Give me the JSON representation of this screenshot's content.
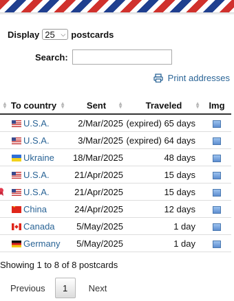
{
  "length": {
    "prefix": "Display",
    "value": "25",
    "suffix": "postcards"
  },
  "search": {
    "label": "Search:",
    "value": "",
    "placeholder": ""
  },
  "print_link": "Print addresses",
  "table": {
    "columns": [
      "To country",
      "Sent",
      "Traveled",
      "Img"
    ],
    "rows": [
      {
        "flag": "us-flag-icon",
        "country": "U.S.A.",
        "sent": "2/Mar/2025",
        "traveled": "(expired) 65 days",
        "marker": ""
      },
      {
        "flag": "us-flag-icon",
        "country": "U.S.A.",
        "sent": "3/Mar/2025",
        "traveled": "(expired) 64 days",
        "marker": ""
      },
      {
        "flag": "ukraine-flag-icon",
        "country": "Ukraine",
        "sent": "18/Mar/2025",
        "traveled": "48 days",
        "marker": ""
      },
      {
        "flag": "us-flag-icon",
        "country": "U.S.A.",
        "sent": "21/Apr/2025",
        "traveled": "15 days",
        "marker": ""
      },
      {
        "flag": "us-flag-icon",
        "country": "U.S.A.",
        "sent": "21/Apr/2025",
        "traveled": "15 days",
        "marker": "ribbon-icon"
      },
      {
        "flag": "china-flag-icon",
        "country": "China",
        "sent": "24/Apr/2025",
        "traveled": "12 days",
        "marker": ""
      },
      {
        "flag": "canada-flag-icon",
        "country": "Canada",
        "sent": "5/May/2025",
        "traveled": "1 day",
        "marker": ""
      },
      {
        "flag": "germany-flag-icon",
        "country": "Germany",
        "sent": "5/May/2025",
        "traveled": "1 day",
        "marker": ""
      }
    ]
  },
  "info": "Showing 1 to 8 of 8 postcards",
  "pagination": {
    "previous": "Previous",
    "current": "1",
    "next": "Next"
  },
  "colors": {
    "link": "#2a6496",
    "airmail_red": "#d0312d",
    "airmail_blue": "#1f3f8f"
  }
}
